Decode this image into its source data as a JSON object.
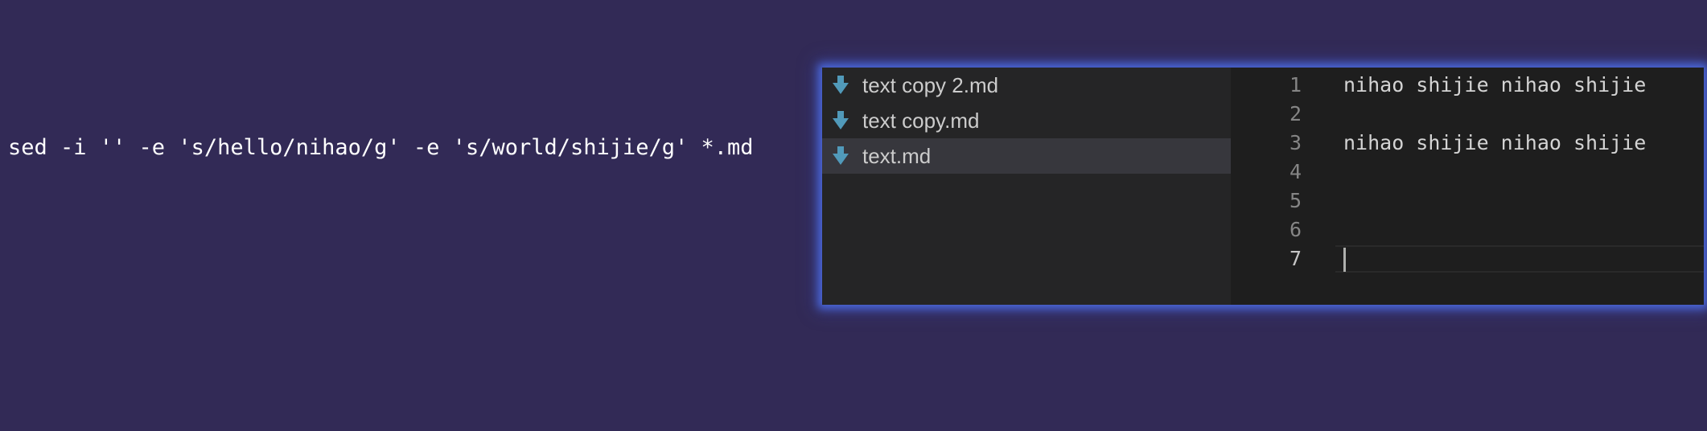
{
  "command": {
    "text": "sed -i '' -e 's/hello/nihao/g' -e 's/world/shijie/g' *.md"
  },
  "explorer": {
    "files": [
      {
        "name": "text copy 2.md",
        "icon": "markdown-download-icon",
        "selected": false
      },
      {
        "name": "text copy.md",
        "icon": "markdown-download-icon",
        "selected": false
      },
      {
        "name": "text.md",
        "icon": "markdown-download-icon",
        "selected": true
      }
    ]
  },
  "editor": {
    "lines": [
      {
        "number": "1",
        "content": "nihao shijie nihao shijie"
      },
      {
        "number": "2",
        "content": ""
      },
      {
        "number": "3",
        "content": "nihao shijie nihao shijie"
      },
      {
        "number": "4",
        "content": ""
      },
      {
        "number": "5",
        "content": ""
      },
      {
        "number": "6",
        "content": ""
      },
      {
        "number": "7",
        "content": ""
      }
    ],
    "current_line": "7"
  },
  "colors": {
    "background": "#322a56",
    "explorer_bg": "#252526",
    "editor_bg": "#1e1e1e",
    "selection_bg": "#37373d",
    "icon_blue": "#519aba",
    "glow": "#4e70eb"
  }
}
